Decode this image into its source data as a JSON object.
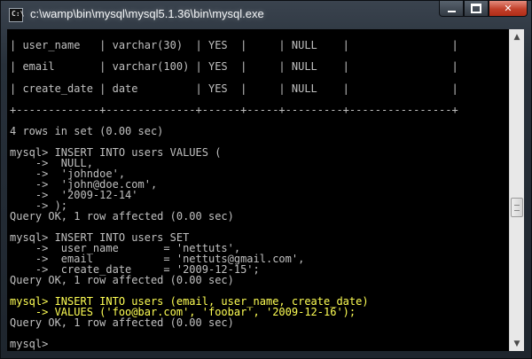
{
  "window": {
    "title": "c:\\wamp\\bin\\mysql\\mysql5.1.36\\bin\\mysql.exe",
    "minimize_glyph": "minimize",
    "maximize_glyph": "maximize",
    "close_glyph": "✕"
  },
  "console": {
    "text_color": "#c0c0c0",
    "highlight_color": "#ffff54",
    "background": "#000000",
    "lines": [
      {
        "text": "| user_name   | varchar(30)  | YES  |     | NULL    |                |"
      },
      {
        "text": "| email       | varchar(100) | YES  |     | NULL    |                |"
      },
      {
        "text": "| create_date | date         | YES  |     | NULL    |                |"
      },
      {
        "text": "+-------------+--------------+------+-----+---------+----------------+"
      },
      {
        "text": "4 rows in set (0.00 sec)"
      },
      {
        "text": "mysql> INSERT INTO users VALUES ("
      },
      {
        "text": "    ->  NULL,"
      },
      {
        "text": "    ->  'johndoe',"
      },
      {
        "text": "    ->  'john@doe.com',"
      },
      {
        "text": "    ->  '2009-12-14'"
      },
      {
        "text": "    -> );"
      },
      {
        "text": "Query OK, 1 row affected (0.00 sec)"
      },
      {
        "text": "mysql> INSERT INTO users SET"
      },
      {
        "text": "    ->  user_name       = 'nettuts',"
      },
      {
        "text": "    ->  email           = 'nettuts@gmail.com',"
      },
      {
        "text": "    ->  create_date     = '2009-12-15';"
      },
      {
        "text": "Query OK, 1 row affected (0.00 sec)"
      },
      {
        "text": "mysql> INSERT INTO users (email, user_name, create_date)",
        "highlight": true
      },
      {
        "text": "    -> VALUES ('foo@bar.com', 'foobar', '2009-12-16');",
        "highlight": true
      },
      {
        "text": "Query OK, 1 row affected (0.00 sec)"
      },
      {
        "text": "mysql>"
      }
    ]
  },
  "scrollbar": {
    "up_arrow": "▲",
    "down_arrow": "▼"
  }
}
